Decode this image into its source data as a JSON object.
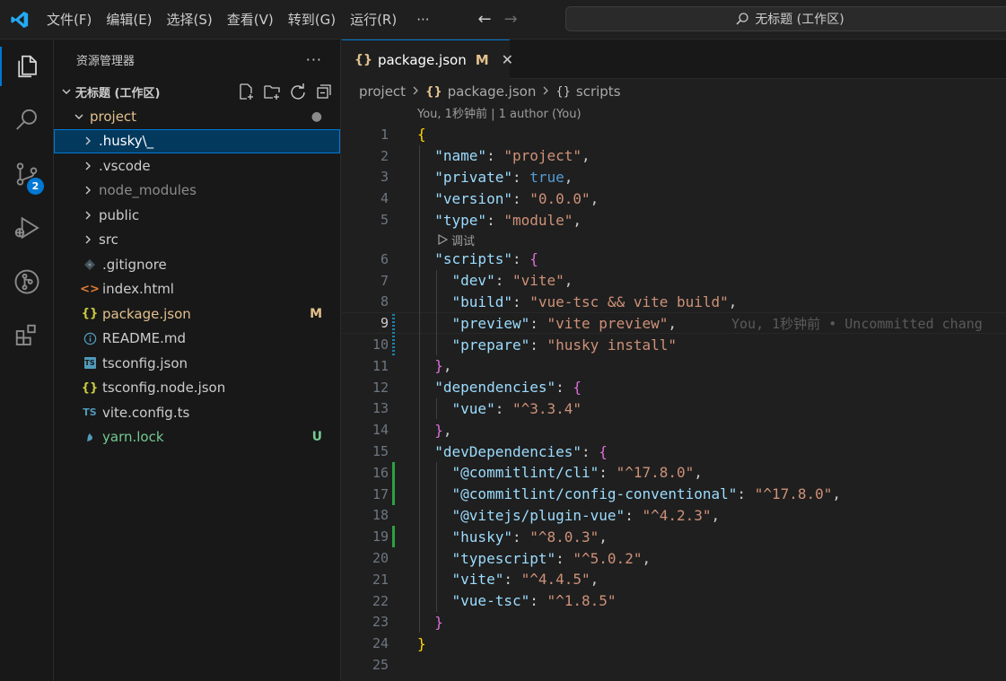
{
  "menu": [
    "文件(F)",
    "编辑(E)",
    "选择(S)",
    "查看(V)",
    "转到(G)",
    "运行(R)"
  ],
  "menu_more": "···",
  "search": {
    "text": "无标题 (工作区)"
  },
  "activity": {
    "scm_badge": "2"
  },
  "sidebar": {
    "title": "资源管理器",
    "workspace": "无标题 (工作区)",
    "tree": [
      {
        "label": "project",
        "type": "folder-open",
        "indent": 0,
        "color": "#e2c08d",
        "status": "●",
        "status_color": "#8b8b8b"
      },
      {
        "label": ".husky\\_",
        "type": "folder",
        "indent": 1,
        "color": "#ffffff",
        "selected": true
      },
      {
        "label": ".vscode",
        "type": "folder",
        "indent": 1,
        "color": "#cccccc"
      },
      {
        "label": "node_modules",
        "type": "folder",
        "indent": 1,
        "color": "#8b8b8b"
      },
      {
        "label": "public",
        "type": "folder",
        "indent": 1,
        "color": "#cccccc"
      },
      {
        "label": "src",
        "type": "folder",
        "indent": 1,
        "color": "#cccccc"
      },
      {
        "label": ".gitignore",
        "type": "file",
        "icon": "git-icon",
        "indent": 1,
        "color": "#cccccc"
      },
      {
        "label": "index.html",
        "type": "file",
        "icon": "html-icon",
        "indent": 1,
        "color": "#cccccc"
      },
      {
        "label": "package.json",
        "type": "file",
        "icon": "json-icon",
        "indent": 1,
        "color": "#e2c08d",
        "status": "M",
        "status_color": "#e2c08d"
      },
      {
        "label": "README.md",
        "type": "file",
        "icon": "info-icon",
        "indent": 1,
        "color": "#cccccc"
      },
      {
        "label": "tsconfig.json",
        "type": "file",
        "icon": "ts-icon",
        "indent": 1,
        "color": "#cccccc"
      },
      {
        "label": "tsconfig.node.json",
        "type": "file",
        "icon": "json-icon",
        "indent": 1,
        "color": "#cccccc"
      },
      {
        "label": "vite.config.ts",
        "type": "file",
        "icon": "ts-text-icon",
        "indent": 1,
        "color": "#cccccc"
      },
      {
        "label": "yarn.lock",
        "type": "file",
        "icon": "yarn-icon",
        "indent": 1,
        "color": "#73c991",
        "status": "U",
        "status_color": "#73c991"
      }
    ]
  },
  "editor": {
    "tab": {
      "icon": "{}",
      "label": "package.json",
      "modified": "M"
    },
    "breadcrumbs": [
      "project",
      "package.json",
      "scripts"
    ],
    "blame_header": "You, 1秒钟前 | 1 author (You)",
    "codelens": "调试",
    "inline_blame": "You, 1秒钟前 • Uncommitted chang",
    "current_line": 9,
    "lines": [
      [
        [
          "{",
          "br1"
        ]
      ],
      [
        [
          "  "
        ],
        [
          "\"name\"",
          "k"
        ],
        [
          ": "
        ],
        [
          "\"project\"",
          "s"
        ],
        [
          ","
        ]
      ],
      [
        [
          "  "
        ],
        [
          "\"private\"",
          "k"
        ],
        [
          ": "
        ],
        [
          "true",
          "b"
        ],
        [
          ","
        ]
      ],
      [
        [
          "  "
        ],
        [
          "\"version\"",
          "k"
        ],
        [
          ": "
        ],
        [
          "\"0.0.0\"",
          "s"
        ],
        [
          ","
        ]
      ],
      [
        [
          "  "
        ],
        [
          "\"type\"",
          "k"
        ],
        [
          ": "
        ],
        [
          "\"module\"",
          "s"
        ],
        [
          ","
        ]
      ],
      [
        [
          "  "
        ],
        [
          "\"scripts\"",
          "k"
        ],
        [
          ": "
        ],
        [
          "{",
          "br2"
        ]
      ],
      [
        [
          "    "
        ],
        [
          "\"dev\"",
          "k"
        ],
        [
          ": "
        ],
        [
          "\"vite\"",
          "s"
        ],
        [
          ","
        ]
      ],
      [
        [
          "    "
        ],
        [
          "\"build\"",
          "k"
        ],
        [
          ": "
        ],
        [
          "\"vue-tsc && vite build\"",
          "s"
        ],
        [
          ","
        ]
      ],
      [
        [
          "    "
        ],
        [
          "\"preview\"",
          "k"
        ],
        [
          ": "
        ],
        [
          "\"vite preview\"",
          "s"
        ],
        [
          ","
        ]
      ],
      [
        [
          "    "
        ],
        [
          "\"prepare\"",
          "k"
        ],
        [
          ": "
        ],
        [
          "\"husky install\"",
          "s"
        ]
      ],
      [
        [
          "  "
        ],
        [
          "}",
          "br2"
        ],
        [
          ","
        ]
      ],
      [
        [
          "  "
        ],
        [
          "\"dependencies\"",
          "k"
        ],
        [
          ": "
        ],
        [
          "{",
          "br2"
        ]
      ],
      [
        [
          "    "
        ],
        [
          "\"vue\"",
          "k"
        ],
        [
          ": "
        ],
        [
          "\"^3.3.4\"",
          "s"
        ]
      ],
      [
        [
          "  "
        ],
        [
          "}",
          "br2"
        ],
        [
          ","
        ]
      ],
      [
        [
          "  "
        ],
        [
          "\"devDependencies\"",
          "k"
        ],
        [
          ": "
        ],
        [
          "{",
          "br2"
        ]
      ],
      [
        [
          "    "
        ],
        [
          "\"@commitlint/cli\"",
          "k"
        ],
        [
          ": "
        ],
        [
          "\"^17.8.0\"",
          "s"
        ],
        [
          ","
        ]
      ],
      [
        [
          "    "
        ],
        [
          "\"@commitlint/config-conventional\"",
          "k"
        ],
        [
          ": "
        ],
        [
          "\"^17.8.0\"",
          "s"
        ],
        [
          ","
        ]
      ],
      [
        [
          "    "
        ],
        [
          "\"@vitejs/plugin-vue\"",
          "k"
        ],
        [
          ": "
        ],
        [
          "\"^4.2.3\"",
          "s"
        ],
        [
          ","
        ]
      ],
      [
        [
          "    "
        ],
        [
          "\"husky\"",
          "k"
        ],
        [
          ": "
        ],
        [
          "\"^8.0.3\"",
          "s"
        ],
        [
          ","
        ]
      ],
      [
        [
          "    "
        ],
        [
          "\"typescript\"",
          "k"
        ],
        [
          ": "
        ],
        [
          "\"^5.0.2\"",
          "s"
        ],
        [
          ","
        ]
      ],
      [
        [
          "    "
        ],
        [
          "\"vite\"",
          "k"
        ],
        [
          ": "
        ],
        [
          "\"^4.4.5\"",
          "s"
        ],
        [
          ","
        ]
      ],
      [
        [
          "    "
        ],
        [
          "\"vue-tsc\"",
          "k"
        ],
        [
          ": "
        ],
        [
          "\"^1.8.5\"",
          "s"
        ]
      ],
      [
        [
          "  "
        ],
        [
          "}",
          "br2"
        ]
      ],
      [
        [
          "}",
          "br1"
        ]
      ],
      [
        [
          ""
        ]
      ]
    ],
    "gutter_added": [
      16,
      17,
      19
    ],
    "gutter_modified": [
      9,
      10
    ]
  },
  "colors": {
    "accent": "#0078d4",
    "modified": "#e2c08d",
    "untracked": "#73c991"
  }
}
